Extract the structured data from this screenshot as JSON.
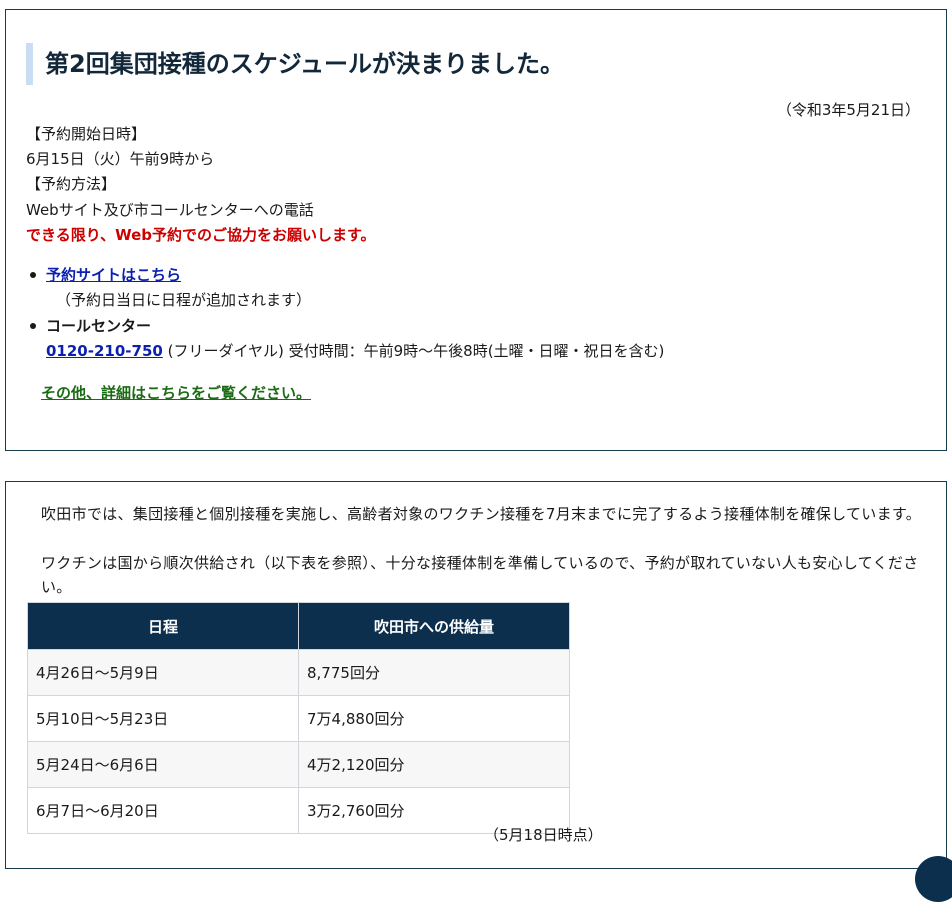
{
  "notice": {
    "title": "第2回集団接種のスケジュールが決まりました。",
    "date": "（令和3年5月21日）",
    "start_label": "【予約開始日時】",
    "start_value": "6月15日（火）午前9時から",
    "method_label": "【予約方法】",
    "method_value": "Webサイト及び市コールセンターへの電話",
    "web_request": "できる限り、Web予約でのご協力をお願いします。",
    "site_link": "予約サイトはこちら",
    "site_note": "（予約日当日に日程が追加されます）",
    "call_center_label": "コールセンター",
    "phone": "0120-210-750",
    "phone_note": " (フリーダイヤル) 受付時間：午前9時～午後8時(土曜・日曜・祝日を含む)",
    "details_link": "その他、詳細はこちらをご覧ください。"
  },
  "supply": {
    "para1": "吹田市では、集団接種と個別接種を実施し、高齢者対象のワクチン接種を7月末までに完了するよう接種体制を確保しています。",
    "para2": "ワクチンは国から順次供給され（以下表を参照）、十分な接種体制を準備しているので、予約が取れていない人も安心してください。",
    "headers": [
      "日程",
      "吹田市への供給量"
    ],
    "rows": [
      [
        "4月26日～5月9日",
        "8,775回分"
      ],
      [
        "5月10日～5月23日",
        "7万4,880回分"
      ],
      [
        "5月24日～6月6日",
        "4万2,120回分"
      ],
      [
        "6月7日～6月20日",
        "3万2,760回分"
      ]
    ],
    "note": "（5月18日時点）"
  },
  "colors": {
    "header_bg": "#0c2f4e",
    "red_text": "#cc0000",
    "link_blue": "#0b1fb0",
    "link_green": "#1a6b13",
    "title_bar": "#c9ddf4"
  }
}
